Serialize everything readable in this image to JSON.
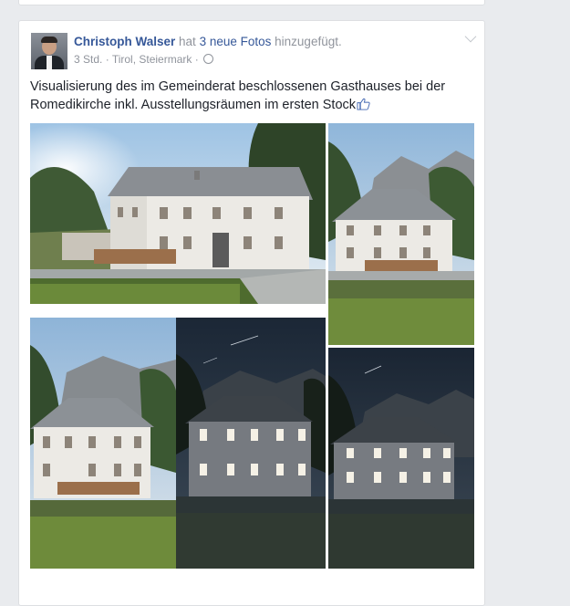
{
  "post": {
    "author": "Christoph Walser",
    "action_prefix": "hat",
    "photos_link": "3 neue Fotos",
    "action_suffix": "hinzugefügt.",
    "time": "3 Std.",
    "separator": "·",
    "location": "Tirol, Steiermark",
    "separator2": "·",
    "text": "Visualisierung des im Gemeinderat beschlossenen Gasthauses bei der Romedikirche inkl. Ausstellungsräumen im ersten Stock"
  },
  "icons": {
    "privacy": "globe-icon",
    "options": "chevron-down-icon",
    "emoticon": "like-icon"
  },
  "colors": {
    "link": "#365899",
    "meta": "#90949c",
    "text": "#1d2129",
    "background": "#e9ebee"
  }
}
